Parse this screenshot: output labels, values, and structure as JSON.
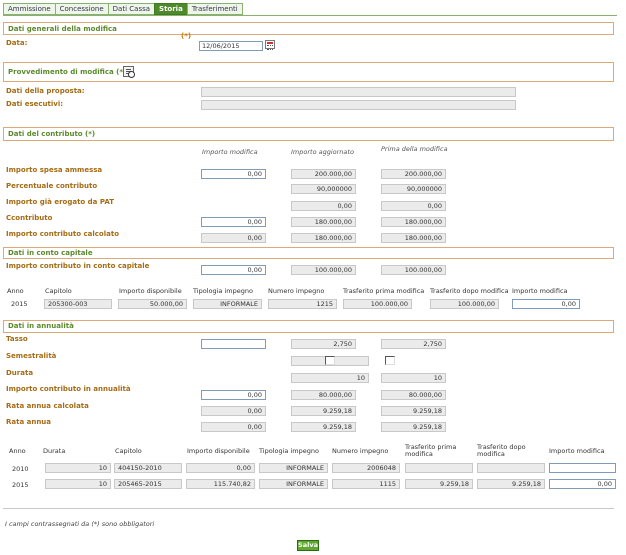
{
  "tabs": [
    "Ammissione",
    "Concessione",
    "Dati Cassa",
    "Storia",
    "Trasferimenti"
  ],
  "active_tab": "Storia",
  "general": {
    "title": "Dati generali della modifica",
    "required_mark": "(*)",
    "data_label": "Data:",
    "data_value": "12/06/2015"
  },
  "provvedimento": {
    "title": "Provvedimento di modifica (*)",
    "proposta_label": "Dati della proposta:",
    "esecutivi_label": "Dati esecutivi:"
  },
  "contributo": {
    "title": "Dati del contributo (*)",
    "columns": [
      "Importo modifica",
      "Importo aggiornato",
      "Prima della modifica"
    ],
    "rows": [
      {
        "label": "Importo spesa ammessa",
        "modifica": "0,00",
        "aggiornato": "200.000,00",
        "prima": "200.000,00"
      },
      {
        "label": "Percentuale contributo",
        "aggiornato": "90,000000",
        "prima": "90,000000"
      },
      {
        "label": "Importo già erogato da PAT",
        "aggiornato": "0,00",
        "prima": "0,00"
      },
      {
        "label": "Ccontributo",
        "modifica": "0,00",
        "aggiornato": "180.000,00",
        "prima": "180.000,00"
      },
      {
        "label": "Importo contributo calcolato",
        "modifica": "0,00",
        "aggiornato": "180.000,00",
        "prima": "180.000,00"
      }
    ]
  },
  "conto_capitale": {
    "title": "Dati in conto capitale",
    "row_label": "Importo contributo in conto capitale",
    "modifica": "0,00",
    "aggiornato": "100.000,00",
    "prima": "100.000,00",
    "table_headers": [
      "Anno",
      "Capitolo",
      "Importo disponibile",
      "Tipologia impegno",
      "Numero impegno",
      "Trasferito prima modifica",
      "Trasferito dopo modifica",
      "Importo modifica"
    ],
    "table_rows": [
      {
        "anno": "2015",
        "capitolo": "205300-003",
        "disponibile": "50.000,00",
        "tipologia": "INFORMALE",
        "numero": "1215",
        "prima": "100.000,00",
        "dopo": "100.000,00",
        "modifica": "0,00"
      }
    ]
  },
  "annualita": {
    "title": "Dati in annualità",
    "tasso_label": "Tasso",
    "tasso_modifica": "",
    "tasso_aggiornato": "2,750",
    "tasso_prima": "2,750",
    "semestralita_label": "Semestralità",
    "durata_label": "Durata",
    "durata_aggiornato": "10",
    "durata_prima": "10",
    "importo_label": "Importo contributo in annualità",
    "importo_modifica": "0,00",
    "importo_aggiornato": "80.000,00",
    "importo_prima": "80.000,00",
    "rata_calc_label": "Rata annua calcolata",
    "rata_calc_modifica": "0,00",
    "rata_calc_aggiornato": "9.259,18",
    "rata_calc_prima": "9.259,18",
    "rata_label": "Rata annua",
    "rata_modifica": "0,00",
    "rata_aggiornato": "9.259,18",
    "rata_prima": "9.259,18",
    "table_headers": [
      "Anno",
      "Durata",
      "Capitolo",
      "Importo disponibile",
      "Tipologia impegno",
      "Numero impegno",
      "Trasferito prima modifica",
      "Trasferito dopo modifica",
      "Importo modifica"
    ],
    "table_rows": [
      {
        "anno": "2010",
        "durata": "10",
        "capitolo": "404150-2010",
        "disponibile": "0,00",
        "tipologia": "INFORMALE",
        "numero": "2006048",
        "prima": "",
        "dopo": "",
        "modifica": ""
      },
      {
        "anno": "2015",
        "durata": "10",
        "capitolo": "205465-2015",
        "disponibile": "115.740,82",
        "tipologia": "INFORMALE",
        "numero": "1115",
        "prima": "9.259,18",
        "dopo": "9.259,18",
        "modifica": "0,00"
      }
    ]
  },
  "footnote": "I campi contrassegnati da (*) sono obbligatori",
  "save_label": "Salva"
}
